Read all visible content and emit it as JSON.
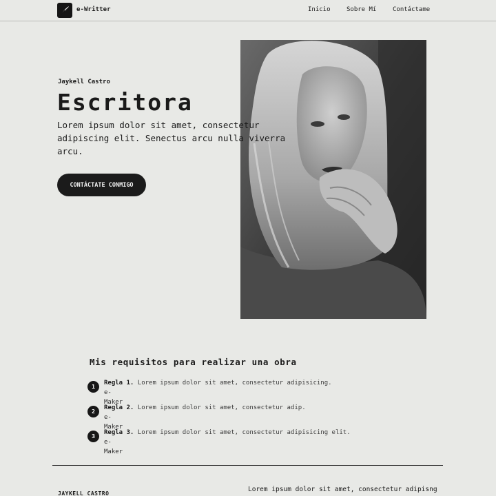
{
  "header": {
    "brand": "e-Writter",
    "nav": [
      "Inicio",
      "Sobre Mí",
      "Contáctame"
    ]
  },
  "hero": {
    "author": "Jaykell Castro",
    "title": "Escritora",
    "intro": "Lorem ipsum dolor sit amet, consectetur adipiscing elit. Senectus arcu nulla viverra arcu.",
    "cta_label": "CONTÁCTATE CONMIGO"
  },
  "requirements": {
    "title": "Mis requisitos para realizar una obra",
    "items": [
      {
        "number": "1",
        "rule": "Regla 1.",
        "text": "Lorem ipsum dolor sit amet, consectetur adipisicing.",
        "author": "e-Maker"
      },
      {
        "number": "2",
        "rule": "Regla 2.",
        "text": "Lorem ipsum dolor sit amet, consectetur adip.",
        "author": "e-Maker"
      },
      {
        "number": "3",
        "rule": "Regla 3.",
        "text": "Lorem ipsum dolor sit amet, consectetur adipisicing elit.",
        "author": "e-Maker"
      }
    ]
  },
  "footer": {
    "name": "JAYKELL CASTRO",
    "text": "Lorem ipsum dolor sit amet, consectetur adipisng"
  },
  "colors": {
    "background": "#e8e9e6",
    "ink": "#1a1a1a"
  },
  "icons": {
    "logo": "quill-icon"
  }
}
